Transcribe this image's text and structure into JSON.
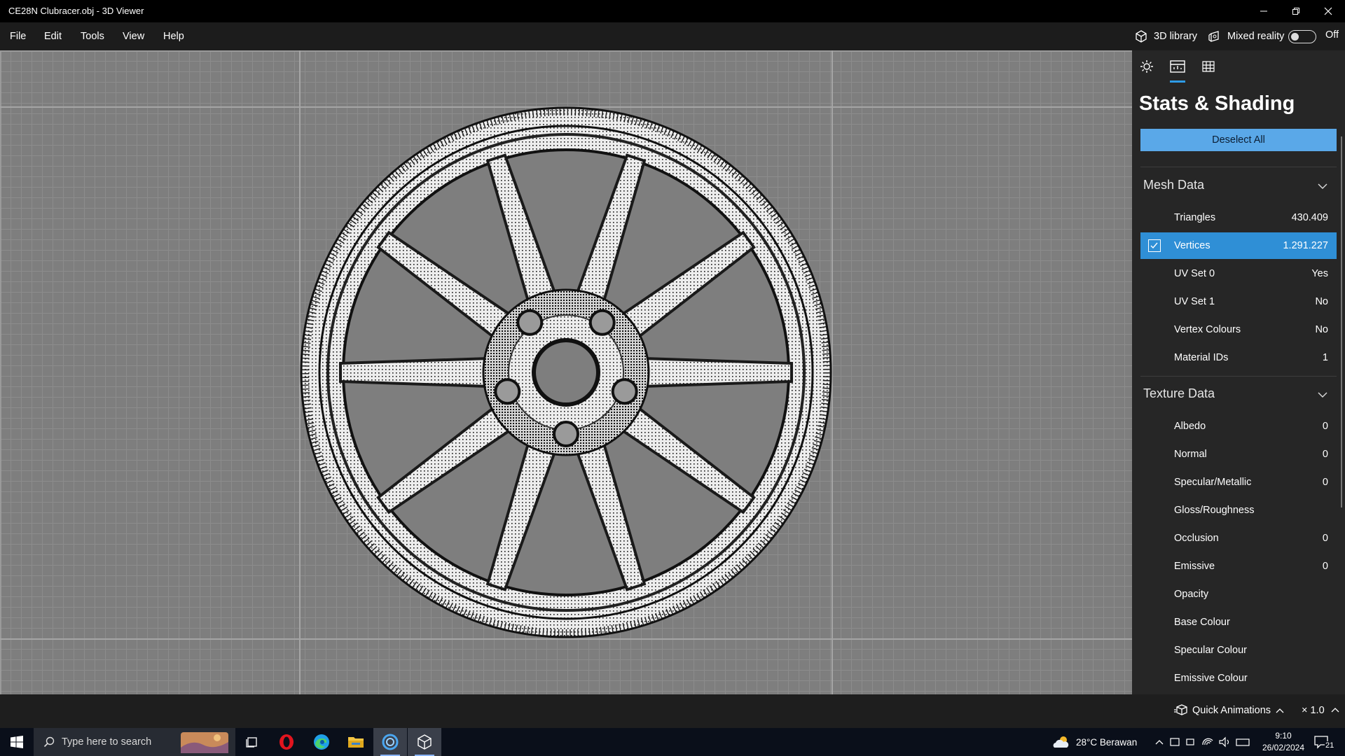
{
  "window": {
    "title": "CE28N Clubracer.obj - 3D Viewer"
  },
  "menu": {
    "items": [
      "File",
      "Edit",
      "Tools",
      "View",
      "Help"
    ]
  },
  "commands": {
    "library_label": "3D library",
    "mixed_reality_label": "Mixed reality",
    "toggle_state": "Off"
  },
  "panel": {
    "title": "Stats & Shading",
    "deselect_label": "Deselect All",
    "mesh": {
      "title": "Mesh Data",
      "rows": [
        {
          "label": "Triangles",
          "value": "430.409"
        },
        {
          "label": "Vertices",
          "value": "1.291.227",
          "checked": true
        },
        {
          "label": "UV Set 0",
          "value": "Yes"
        },
        {
          "label": "UV Set 1",
          "value": "No"
        },
        {
          "label": "Vertex Colours",
          "value": "No"
        },
        {
          "label": "Material IDs",
          "value": "1"
        }
      ]
    },
    "texture": {
      "title": "Texture Data",
      "rows": [
        {
          "label": "Albedo",
          "value": "0"
        },
        {
          "label": "Normal",
          "value": "0"
        },
        {
          "label": "Specular/Metallic",
          "value": "0"
        },
        {
          "label": "Gloss/Roughness",
          "value": ""
        },
        {
          "label": "Occlusion",
          "value": "0"
        },
        {
          "label": "Emissive",
          "value": "0"
        },
        {
          "label": "Opacity",
          "value": ""
        },
        {
          "label": "Base Colour",
          "value": ""
        },
        {
          "label": "Specular Colour",
          "value": ""
        },
        {
          "label": "Emissive Colour",
          "value": ""
        }
      ]
    }
  },
  "status": {
    "quick_animations": "Quick Animations",
    "zoom": "× 1.0"
  },
  "taskbar": {
    "search_placeholder": "Type here to search",
    "weather": "28°C  Berawan",
    "time": "9:10",
    "date": "26/02/2024",
    "notifications": "21"
  },
  "colors": {
    "accent": "#2f8fd6",
    "button": "#5aa8e8",
    "panel": "#262626",
    "viewport": "#7e7e7e"
  }
}
